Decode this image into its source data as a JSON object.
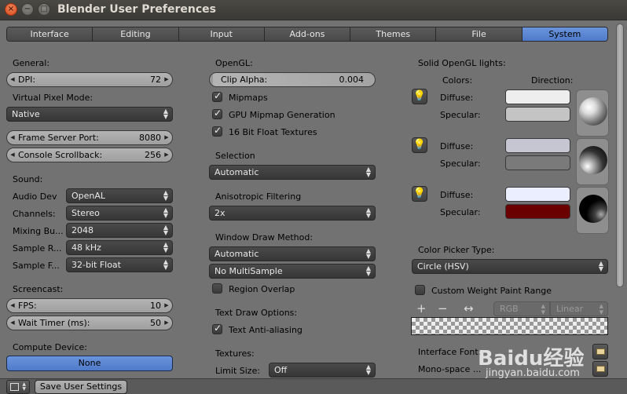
{
  "window": {
    "title": "Blender User Preferences"
  },
  "tabs": [
    "Interface",
    "Editing",
    "Input",
    "Add-ons",
    "Themes",
    "File",
    "System"
  ],
  "col1": {
    "general_label": "General:",
    "dpi": {
      "label": "DPI:",
      "value": "72"
    },
    "virtual_pixel_label": "Virtual Pixel Mode:",
    "virtual_pixel_value": "Native",
    "frame_server": {
      "label": "Frame Server Port:",
      "value": "8080"
    },
    "console_scrollback": {
      "label": "Console Scrollback:",
      "value": "256"
    },
    "sound_label": "Sound:",
    "audio_dev": {
      "label": "Audio Dev",
      "value": "OpenAL"
    },
    "channels": {
      "label": "Channels:",
      "value": "Stereo"
    },
    "mixing_buffer": {
      "label": "Mixing Bu...",
      "value": "2048"
    },
    "sample_rate": {
      "label": "Sample R...",
      "value": "48 kHz"
    },
    "sample_format": {
      "label": "Sample F...",
      "value": "32-bit Float"
    },
    "screencast_label": "Screencast:",
    "fps": {
      "label": "FPS:",
      "value": "10"
    },
    "wait_timer": {
      "label": "Wait Timer (ms):",
      "value": "50"
    },
    "compute_label": "Compute Device:",
    "compute_value": "None"
  },
  "col2": {
    "opengl_label": "OpenGL:",
    "clip_alpha": {
      "label": "Clip Alpha:",
      "value": "0.004"
    },
    "mipmaps": "Mipmaps",
    "gpu_mipmap": "GPU Mipmap Generation",
    "float_textures": "16 Bit Float Textures",
    "selection_label": "Selection",
    "selection_value": "Automatic",
    "aniso_label": "Anisotropic Filtering",
    "aniso_value": "2x",
    "window_draw_label": "Window Draw Method:",
    "window_draw_value": "Automatic",
    "multisample_value": "No MultiSample",
    "region_overlap": "Region Overlap",
    "text_draw_label": "Text Draw Options:",
    "text_aa": "Text Anti-aliasing",
    "textures_label": "Textures:",
    "limit_size_label": "Limit Size:",
    "limit_size_value": "Off"
  },
  "col3": {
    "solid_lights_label": "Solid OpenGL lights:",
    "colors_label": "Colors:",
    "direction_label": "Direction:",
    "diffuse_label": "Diffuse:",
    "specular_label": "Specular:",
    "lights": [
      {
        "diffuse_color": "#eeeeee",
        "specular_color": "#c4c4c4"
      },
      {
        "diffuse_color": "#c6c6d2",
        "specular_color": "#7a7a7a"
      },
      {
        "diffuse_color": "#ebeefe",
        "specular_color": "#6a0000"
      }
    ],
    "color_picker_label": "Color Picker Type:",
    "color_picker_value": "Circle (HSV)",
    "custom_weight": "Custom Weight Paint Range",
    "rgb_value": "RGB",
    "linear_value": "Linear",
    "interface_font_label": "Interface Font:",
    "mono_font_label": "Mono-space ..."
  },
  "footer": {
    "save_label": "Save User Settings"
  },
  "watermark": {
    "text": "Baidu经验",
    "url": "jingyan.baidu.com"
  }
}
